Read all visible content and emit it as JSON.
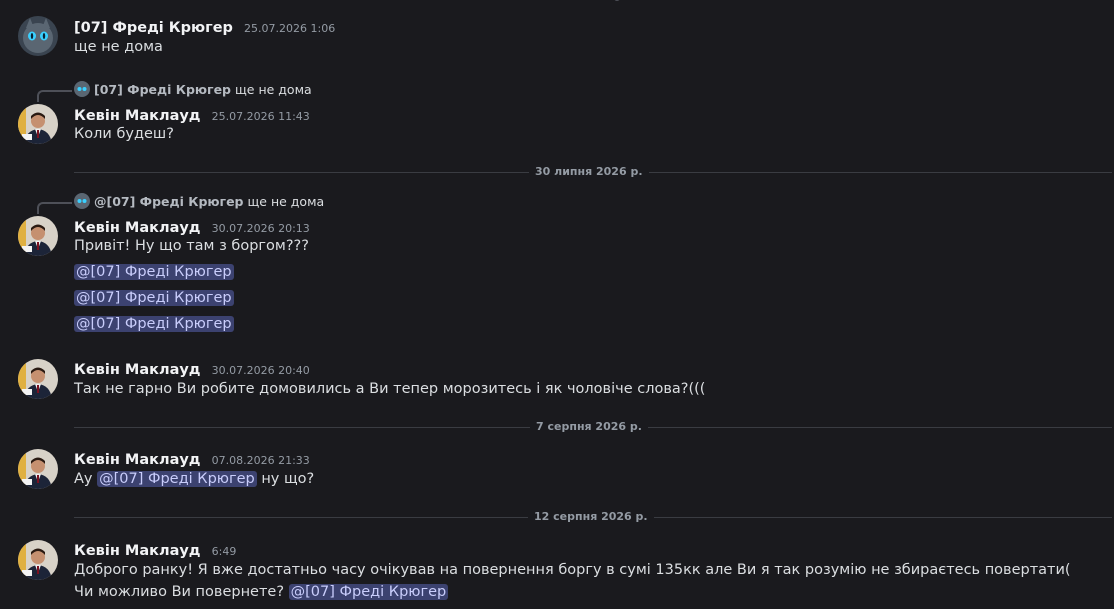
{
  "colors": {
    "background": "#1a1a1e",
    "mention_bg": "#3c4270",
    "mention_text": "#c9cdfb",
    "author": "#f2f3f5",
    "timestamp": "#949ba4"
  },
  "messages": {
    "m1": {
      "author": "[07] Фреді Крюгер",
      "time": "25.07.2026 1:06",
      "text": "ще не дома",
      "avatar": "cat-avatar-icon"
    },
    "m2": {
      "reply_author": "[07] Фреді Крюгер",
      "reply_text": "ще не дома",
      "author": "Кевін Маклауд",
      "time": "25.07.2026 11:43",
      "text": "Коли будеш?",
      "avatar": "man-in-suit-avatar-icon"
    },
    "divider1": "30 липня 2026 р.",
    "m3": {
      "reply_author": "@[07] Фреді Крюгер",
      "reply_text": "ще не дома",
      "author": "Кевін Маклауд",
      "time": "30.07.2026 20:13",
      "text": "Привіт! Ну що там з боргом???",
      "mention1": "@[07] Фреді Крюгер",
      "mention2": "@[07] Фреді Крюгер",
      "mention3": "@[07] Фреді Крюгер"
    },
    "m4": {
      "author": "Кевін Маклауд",
      "time": "30.07.2026 20:40",
      "text": "Так не гарно Ви робите домовились а Ви тепер морозитесь і як чоловіче слова?((("
    },
    "divider2": "7 серпня 2026 р.",
    "m5": {
      "author": "Кевін Маклауд",
      "time": "07.08.2026 21:33",
      "text_before": "Ау",
      "mention": "@[07] Фреді Крюгер",
      "text_after": "ну що?"
    },
    "divider3": "12 серпня 2026 р.",
    "m6": {
      "author": "Кевін Маклауд",
      "time": "6:49",
      "text": "Доброго ранку! Я вже достатньо часу очікував на повернення боргу в сумі 135кк але Ви я так розумію не збираєтесь повертати( Чи можливо Ви повернете?",
      "mention": "@[07] Фреді Крюгер"
    }
  }
}
